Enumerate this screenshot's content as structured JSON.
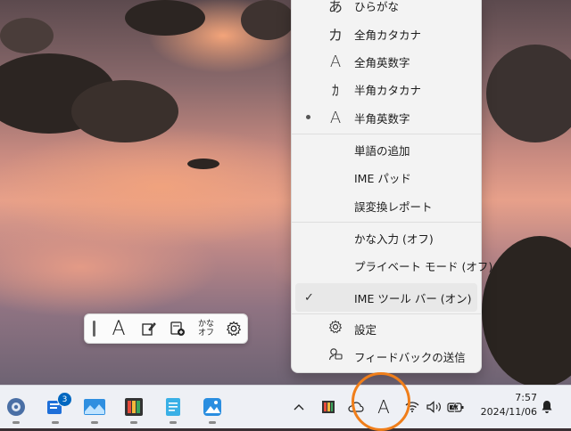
{
  "ime_menu": {
    "items": [
      {
        "label": "ひらがな",
        "icon": "あ"
      },
      {
        "label": "全角カタカナ",
        "icon": "カ"
      },
      {
        "label": "全角英数字",
        "icon": "A"
      },
      {
        "label": "半角カタカナ",
        "icon": "ｶ"
      },
      {
        "label": "半角英数字",
        "icon": "A",
        "selected": true
      }
    ],
    "tools": [
      {
        "label": "単語の追加"
      },
      {
        "label": "IME パッド"
      },
      {
        "label": "誤変換レポート"
      }
    ],
    "toggles": [
      {
        "label": "かな入力 (オフ)"
      },
      {
        "label": "プライベート モード (オフ)"
      },
      {
        "label": "IME ツール バー (オン)",
        "checked": true
      }
    ],
    "settings_label": "設定",
    "feedback_label": "フィードバックの送信"
  },
  "ime_toolbar": {
    "mode_glyph": "A",
    "kana_label_top": "かな",
    "kana_label_bottom": "オフ",
    "icons": [
      "grip-icon",
      "input-mode-icon",
      "ime-pad-icon",
      "add-word-icon",
      "kana-input-icon",
      "settings-icon"
    ]
  },
  "taskbar": {
    "apps": [
      "settings-app",
      "messaging-app",
      "photos-viewer-app",
      "color-tool-app",
      "notepad-app",
      "photos-app"
    ],
    "messaging_badge": "3",
    "tray": {
      "overflow_glyph": "^",
      "ime_glyph": "A"
    },
    "clock": {
      "time": "7:57",
      "date": "2024/11/06"
    }
  },
  "colors": {
    "highlight": "#f07e1a",
    "accent": "#0067c0",
    "badge": "#0067c0"
  }
}
